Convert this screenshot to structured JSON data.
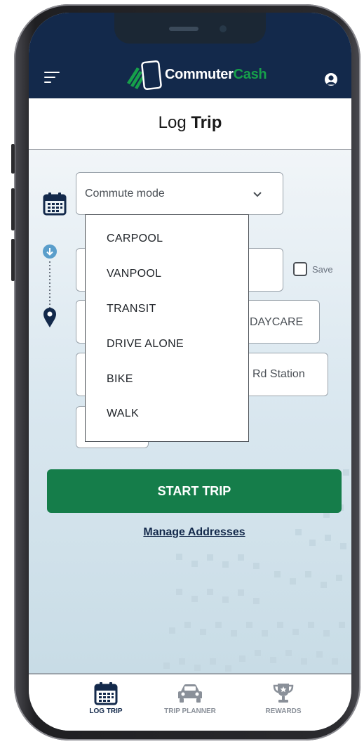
{
  "header": {
    "logo_commuter": "Commuter",
    "logo_cash": "Cash",
    "menu_icon": "hamburger-menu-icon",
    "profile_icon": "user-account-icon"
  },
  "page": {
    "title_light": "Log ",
    "title_bold": "Trip"
  },
  "form": {
    "commute_mode_placeholder": "Commute mode",
    "save_label": "Save",
    "destination_value": "DAYCARE",
    "station_value": "Rd Station"
  },
  "dropdown": {
    "options": [
      "CARPOOL",
      "VANPOOL",
      "TRANSIT",
      "DRIVE ALONE",
      "BIKE",
      "WALK"
    ]
  },
  "actions": {
    "start_trip": "START TRIP",
    "manage_addresses": "Manage Addresses"
  },
  "bottom_nav": {
    "items": [
      {
        "label": "LOG TRIP",
        "icon": "calendar-icon",
        "active": true
      },
      {
        "label": "TRIP PLANNER",
        "icon": "car-icon",
        "active": false
      },
      {
        "label": "REWARDS",
        "icon": "trophy-icon",
        "active": false
      }
    ]
  },
  "colors": {
    "navy": "#13294b",
    "brand_green": "#16a04a",
    "button_green": "#157d4a",
    "accent_blue": "#5a9ecb"
  }
}
